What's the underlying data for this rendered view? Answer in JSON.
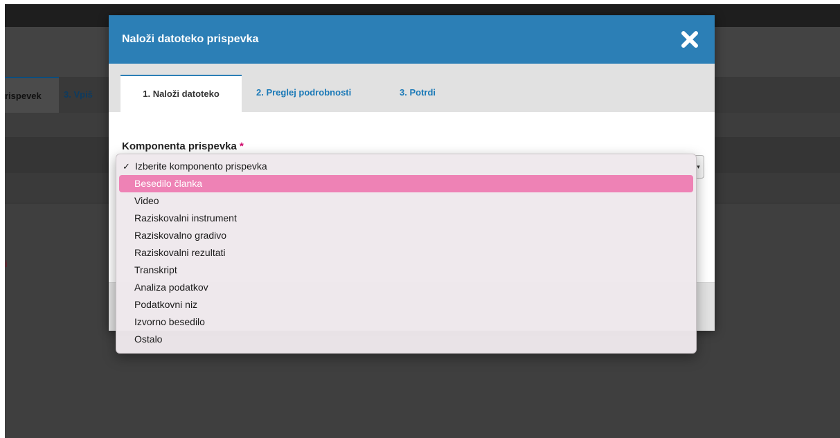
{
  "background": {
    "active_tab": "rispevek",
    "tab3_label": "3. Vpiš",
    "accent_color": "#0b4d7e"
  },
  "modal": {
    "title": "Naloži datoteko prispevka",
    "close_icon": "close-icon",
    "header_color": "#2c7fb6",
    "tabs": [
      {
        "label": "1. Naloži datoteko"
      },
      {
        "label": "2. Preglej podrobnosti"
      },
      {
        "label": "3. Potrdi"
      }
    ],
    "field": {
      "label": "Komponenta prispevka",
      "required_mark": "*"
    }
  },
  "dropdown": {
    "highlight_color": "#ee82b5",
    "options": [
      {
        "label": "Izberite komponento prispevka",
        "checked": true
      },
      {
        "label": "Besedilo članka",
        "highlighted": true
      },
      {
        "label": "Video"
      },
      {
        "label": "Raziskovalni instrument"
      },
      {
        "label": "Raziskovalno gradivo"
      },
      {
        "label": "Raziskovalni rezultati"
      },
      {
        "label": "Transkript"
      },
      {
        "label": "Analiza podatkov"
      },
      {
        "label": "Podatkovni niz"
      },
      {
        "label": "Izvorno besedilo"
      },
      {
        "label": "Ostalo"
      }
    ]
  }
}
